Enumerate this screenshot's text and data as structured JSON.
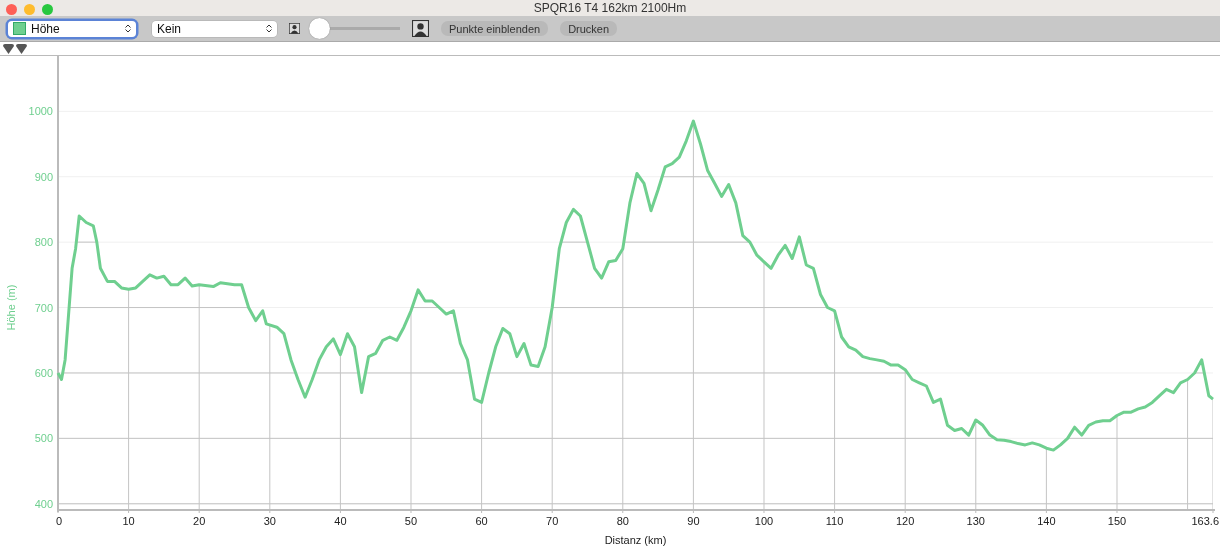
{
  "window": {
    "title": "SPQR16 T4 162km 2100Hm"
  },
  "toolbar": {
    "metric_select": {
      "focused": true
    },
    "compare_select": {
      "value": "Kein",
      "focused": false
    },
    "zoom_slider": {
      "level": 0.08
    },
    "buttons": [
      "Punkte einblenden",
      "Drucken"
    ]
  },
  "chart": {
    "chart_data": {
      "type": "line",
      "xlabel": "Distanz (km)",
      "ylabel": "Höhe (m)",
      "xlim": [
        0,
        163.6
      ],
      "ylim": [
        392,
        1080
      ],
      "grid": true,
      "xticks": [
        0,
        10,
        20,
        30,
        40,
        50,
        60,
        70,
        80,
        90,
        100,
        110,
        120,
        130,
        140,
        150,
        {
          "value": 163.6,
          "label": "163.6"
        }
      ],
      "yticks": [
        400,
        500,
        600,
        700,
        800,
        900,
        1000
      ],
      "x": [
        0,
        0.5,
        1,
        2,
        2.5,
        3,
        4,
        5,
        5.5,
        6,
        7,
        8,
        9,
        10,
        11,
        12,
        13,
        14,
        15,
        16,
        17,
        18,
        19,
        20,
        22,
        23,
        25,
        26,
        27,
        28,
        29,
        29.5,
        31,
        32,
        33,
        34,
        35,
        36,
        37,
        38,
        39,
        40,
        41,
        42,
        43,
        44,
        45,
        46,
        47,
        48,
        49,
        50,
        51,
        52,
        53,
        54,
        55,
        56,
        57,
        58,
        59,
        60,
        61,
        62,
        63,
        64,
        65,
        66,
        67,
        68,
        69,
        70,
        71,
        72,
        73,
        74,
        75,
        76,
        77,
        78,
        79,
        80,
        81,
        82,
        83,
        84,
        85,
        86,
        87,
        88,
        89,
        90,
        91,
        92,
        93,
        94,
        95,
        96,
        97,
        98,
        99,
        100,
        101,
        102,
        103,
        104,
        105,
        106,
        107,
        108,
        109,
        110,
        111,
        112,
        113,
        114,
        115,
        116,
        117,
        118,
        119,
        120,
        121,
        122,
        123,
        124,
        125,
        126,
        127,
        128,
        129,
        130,
        131,
        132,
        133,
        134,
        135,
        136,
        137,
        138,
        139,
        140,
        141,
        142,
        143,
        144,
        145,
        146,
        147,
        148,
        149,
        150,
        151,
        152,
        153,
        154,
        155,
        156,
        157,
        158,
        159,
        160,
        161,
        162,
        163,
        163.6
      ],
      "series": [
        {
          "name": "Höhe",
          "color": "#6fcf8f",
          "values": [
            600,
            590,
            620,
            760,
            790,
            840,
            830,
            825,
            800,
            760,
            740,
            740,
            730,
            728,
            730,
            740,
            750,
            745,
            748,
            735,
            735,
            745,
            733,
            735,
            732,
            738,
            735,
            735,
            700,
            680,
            695,
            675,
            670,
            660,
            620,
            590,
            563,
            590,
            620,
            640,
            652,
            628,
            660,
            640,
            570,
            625,
            630,
            650,
            655,
            650,
            670,
            695,
            727,
            710,
            710,
            700,
            690,
            695,
            645,
            620,
            560,
            555,
            600,
            640,
            668,
            660,
            625,
            645,
            612,
            610,
            640,
            700,
            790,
            830,
            850,
            840,
            800,
            760,
            745,
            770,
            772,
            790,
            860,
            905,
            890,
            848,
            880,
            915,
            920,
            930,
            955,
            985,
            950,
            910,
            890,
            870,
            888,
            860,
            810,
            800,
            780,
            770,
            760,
            780,
            795,
            775,
            808,
            765,
            760,
            720,
            700,
            695,
            655,
            640,
            635,
            625,
            622,
            620,
            618,
            612,
            612,
            605,
            590,
            585,
            580,
            555,
            560,
            520,
            512,
            515,
            505,
            528,
            520,
            505,
            498,
            497,
            495,
            492,
            490,
            493,
            490,
            485,
            482,
            490,
            500,
            517,
            505,
            520,
            525,
            527,
            527,
            535,
            540,
            540,
            545,
            548,
            555,
            565,
            575,
            570,
            585,
            590,
            600,
            620,
            565,
            560
          ]
        }
      ]
    }
  }
}
